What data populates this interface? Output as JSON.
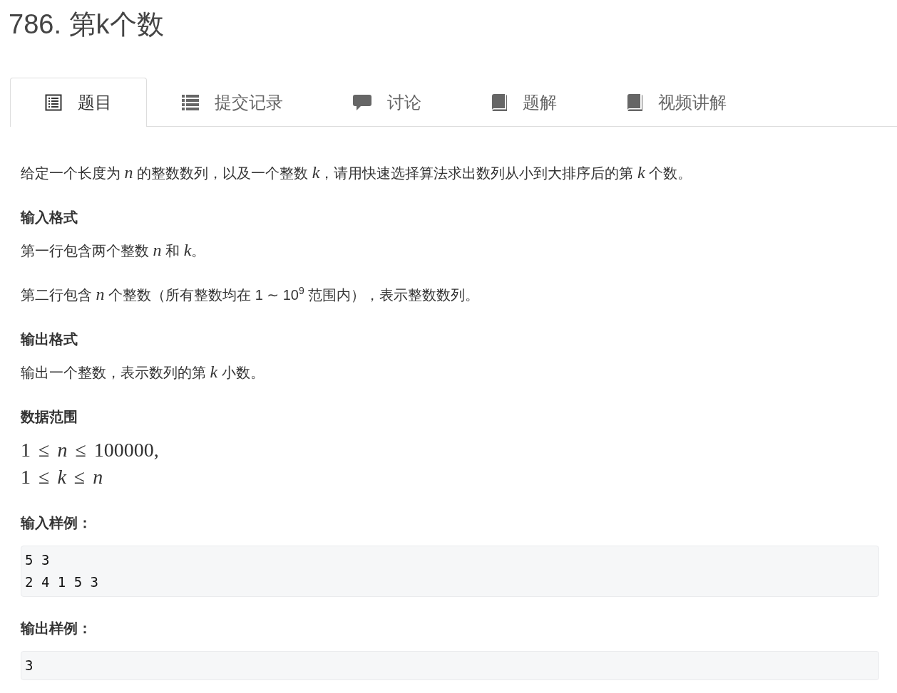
{
  "title": "786. 第k个数",
  "tabs": [
    {
      "label": "题目",
      "kind": "statement",
      "selected": true
    },
    {
      "label": "提交记录",
      "kind": "submissions",
      "selected": false
    },
    {
      "label": "讨论",
      "kind": "discussion",
      "selected": false
    },
    {
      "label": "题解",
      "kind": "solution",
      "selected": false
    },
    {
      "label": "视频讲解",
      "kind": "video",
      "selected": false
    }
  ],
  "problem": {
    "sections": [
      {
        "kind": "paragraph",
        "text": "给定一个长度为 *n* 的整数数列，以及一个整数 *k*，请用快速选择算法求出数列从小到大排序后的第 *k* 个数。"
      },
      {
        "kind": "heading",
        "text": "输入格式"
      },
      {
        "kind": "paragraph",
        "text": "第一行包含两个整数 *n* 和 *k*。"
      },
      {
        "kind": "paragraph",
        "text": "第二行包含 *n* 个整数（所有整数均在 1 ∼ 10$^{9}$ 范围内），表示整数数列。"
      },
      {
        "kind": "heading",
        "text": "输出格式"
      },
      {
        "kind": "paragraph",
        "text": "输出一个整数，表示数列的第 *k* 小数。"
      },
      {
        "kind": "heading",
        "text": "数据范围"
      },
      {
        "kind": "math",
        "lines": [
          "1 ≤ *n* ≤ 100000,",
          "1 ≤ *k* ≤ *n*"
        ]
      },
      {
        "kind": "heading",
        "text": "输入样例："
      },
      {
        "kind": "code",
        "lines": [
          "5 3",
          "2 4 1 5 3"
        ]
      },
      {
        "kind": "heading",
        "text": "输出样例："
      },
      {
        "kind": "code",
        "lines": [
          "3"
        ]
      }
    ]
  }
}
